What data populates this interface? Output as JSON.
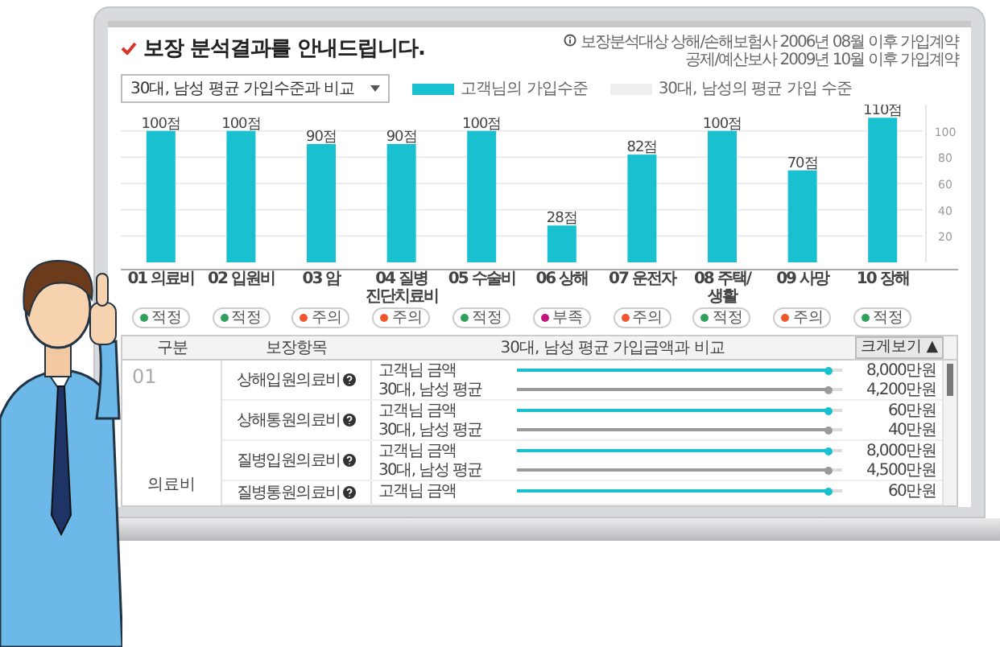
{
  "header": {
    "title": "보장 분석결과를 안내드립니다.",
    "notes": [
      "보장분석대상 상해/손해보험사 2006년 08월 이후 가입계약",
      "공제/예산보사 2009년 10월 이후 가입계약"
    ]
  },
  "compare_select": {
    "value": "30대, 남성 평균 가입수준과 비교"
  },
  "chart": {
    "average_legend": {
      "label": "30대, 남성의 평균 가입 수준",
      "color": "#eeeeee"
    },
    "chart_data": {
      "type": "bar",
      "categories": [
        "01 의료비",
        "02 입원비",
        "03 암",
        "04 질병 진단치료비",
        "05 수술비",
        "06 상해",
        "07 운전자",
        "08 주택/생활",
        "09 사망",
        "10 장해"
      ],
      "series": [
        {
          "name": "고객님의 가입수준",
          "color": "#19c0cf",
          "values": [
            100,
            100,
            90,
            90,
            100,
            28,
            82,
            100,
            70,
            110
          ]
        }
      ],
      "value_labels": [
        "100점",
        "100점",
        "90점",
        "90점",
        "100점",
        "28점",
        "82점",
        "100점",
        "70점",
        "110점"
      ],
      "grid": true,
      "ylim": [
        0,
        120
      ],
      "yticks": [
        20,
        40,
        60,
        80,
        100
      ]
    },
    "statuses": [
      {
        "label": "적정",
        "color": "#2fa05a"
      },
      {
        "label": "적정",
        "color": "#2fa05a"
      },
      {
        "label": "주의",
        "color": "#f0562e"
      },
      {
        "label": "주의",
        "color": "#f0562e"
      },
      {
        "label": "적정",
        "color": "#2fa05a"
      },
      {
        "label": "부족",
        "color": "#c0157a"
      },
      {
        "label": "주의",
        "color": "#f0562e"
      },
      {
        "label": "적정",
        "color": "#2fa05a"
      },
      {
        "label": "주의",
        "color": "#f0562e"
      },
      {
        "label": "적정",
        "color": "#2fa05a"
      }
    ]
  },
  "table": {
    "columns": [
      "구분",
      "보장항목",
      "30대, 남성 평균 가입금액과 비교"
    ],
    "expand_button": "크게보기 ▲",
    "group": {
      "number": "01",
      "name": "의료비"
    },
    "rows": [
      {
        "item": "상해입원의료비",
        "lines": [
          {
            "kind": "customer",
            "label": "고객님 금액",
            "level": 0.96,
            "amount": "8,000만원"
          },
          {
            "kind": "average",
            "label": "30대, 남성 평균",
            "level": 0.96,
            "amount": "4,200만원"
          }
        ]
      },
      {
        "item": "상해통원의료비",
        "lines": [
          {
            "kind": "customer",
            "label": "고객님 금액",
            "level": 0.96,
            "amount": "60만원"
          },
          {
            "kind": "average",
            "label": "30대, 남성 평균",
            "level": 0.96,
            "amount": "40만원"
          }
        ]
      },
      {
        "item": "질병입원의료비",
        "lines": [
          {
            "kind": "customer",
            "label": "고객님 금액",
            "level": 0.96,
            "amount": "8,000만원"
          },
          {
            "kind": "average",
            "label": "30대, 남성 평균",
            "level": 0.96,
            "amount": "4,500만원"
          }
        ]
      },
      {
        "item": "질병통원의료비",
        "lines": [
          {
            "kind": "customer",
            "label": "고객님 금액",
            "level": 0.96,
            "amount": "60만원"
          }
        ]
      }
    ]
  }
}
